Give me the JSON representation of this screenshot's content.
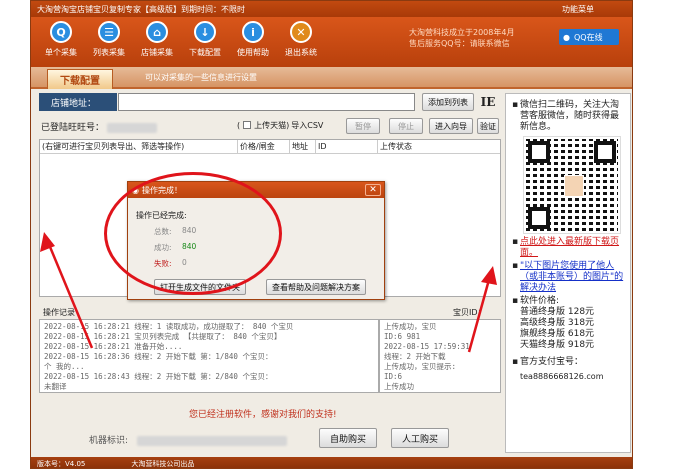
{
  "window": {
    "title": "大淘营淘宝店铺宝贝复制专家【高级版】到期时间：不限时",
    "menu_label": "功能菜单"
  },
  "toolbar": {
    "items": [
      {
        "label": "单个采集",
        "glyph": "Q",
        "color": "#2a8ee0"
      },
      {
        "label": "列表采集",
        "glyph": "☰",
        "color": "#2a8ee0"
      },
      {
        "label": "店铺采集",
        "glyph": "⌂",
        "color": "#2a8ee0"
      },
      {
        "label": "下载配置",
        "glyph": "↓",
        "color": "#2a8ee0"
      },
      {
        "label": "使用帮助",
        "glyph": "i",
        "color": "#2a8ee0"
      },
      {
        "label": "退出系统",
        "glyph": "✕",
        "color": "#e08a1a"
      }
    ],
    "brand_line1": "大淘营科技成立于2008年4月",
    "brand_line2": "售后服务QQ号：请联系微信",
    "qq_label": "QQ在线"
  },
  "tabs": {
    "active": "下载配置",
    "hint": "可以对采集的一些信息进行设置"
  },
  "shop": {
    "label": "店铺地址：",
    "add_button": "添加到列表",
    "ie_button": "IE"
  },
  "controls": {
    "ww_label": "已登陆旺旺号：",
    "checkbox_label": "上传天猫",
    "import_csv": "导入CSV",
    "pause": "暂停",
    "stop": "停止",
    "wizard": "进入向导",
    "verify": "验证"
  },
  "grid": {
    "columns": [
      "(右键可进行宝贝列表导出、筛选等操作)",
      "价格/闸金",
      "地址",
      "ID",
      "上传状态"
    ]
  },
  "log": {
    "title": "操作记录",
    "baby_id_label": "宝贝ID：",
    "lines": [
      "2022-08-15 16:28:21  线程：1  读取成功，成功提取了：  840  个宝贝",
      "2022-08-15 16:28:21  宝贝列表完成 【共提取了：  840  个宝贝】",
      "2022-08-15 16:28:21  准备开始....",
      "2022-08-15 16:28:36  线程：2  开始下载 第：1/840 个宝贝：",
      "                              个 我的...",
      "2022-08-15 16:28:43  线程：2  开始下载 第：2/840 个宝贝：",
      "                              未翻译"
    ],
    "right_lines": [
      "上传成功，宝贝",
      "ID:6       981",
      "2022-08-15 17:59:31",
      "线程：2 开始下载",
      "上传成功，宝贝提示:",
      "ID:6",
      "上传成功"
    ]
  },
  "footer": {
    "thanks": "您已经注册软件，感谢对我们的支持!",
    "machine_label": "机器标识:",
    "self_buy": "自助购买",
    "manual_buy": "人工购买"
  },
  "dialog": {
    "title": "操作完成！",
    "done_text": "操作已经完成:",
    "total_label": "总数:",
    "total_value": "840",
    "success_label": "成功:",
    "success_value": "840",
    "fail_label": "失败:",
    "fail_value": "0",
    "open_folder": "打开生成文件的文件夹",
    "help_button": "查看帮助及问题解决方案"
  },
  "sidebar": {
    "wechat_text": "微信扫二维码，关注大淘营客服微信，随时获得最新信息。",
    "download_link": "点此处进入最新版下载页面。",
    "image_link": "\"以下图片您使用了他人（或非本账号）的图片\"的解决办法",
    "price_title": "软件价格:",
    "prices": [
      "普通终身版 128元",
      "高级终身版 318元",
      "旗舰终身版 618元",
      "天猫终身版 918元"
    ],
    "pay_title": "官方支付宝号：",
    "pay_account": "tea8886668126.com"
  },
  "statusbar": {
    "version": "版本号：V4.05",
    "company": "大淘营科技公司出品"
  }
}
